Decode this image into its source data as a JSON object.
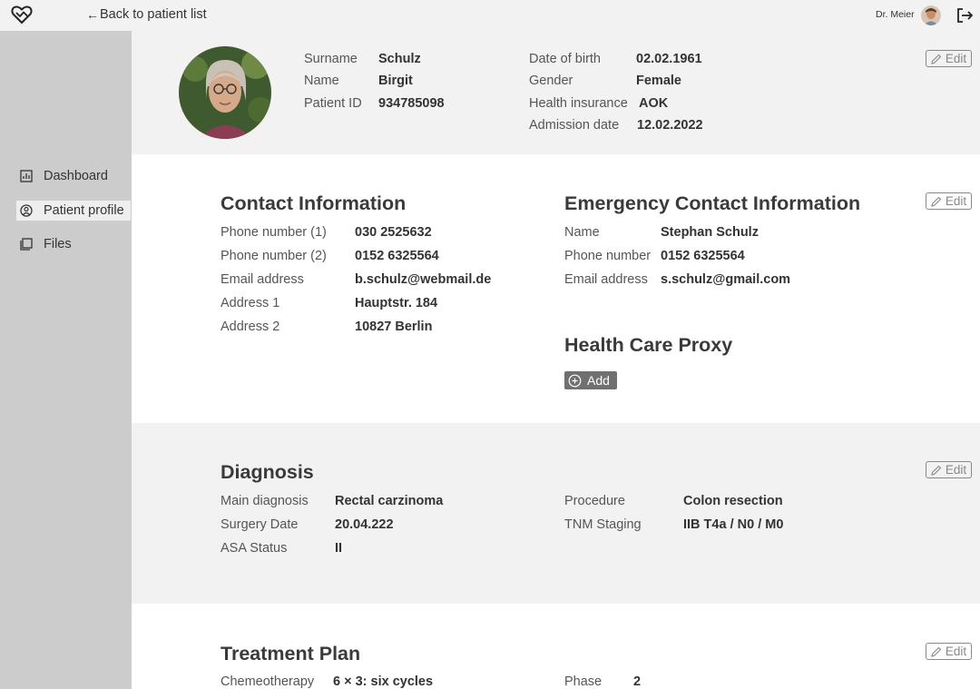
{
  "topbar": {
    "back_label": "Back to patient list",
    "user_name": "Dr. Meier"
  },
  "sidebar": {
    "items": [
      {
        "label": "Dashboard",
        "icon": "chart-icon"
      },
      {
        "label": "Patient profile",
        "icon": "user-circle-icon"
      },
      {
        "label": "Files",
        "icon": "files-icon"
      }
    ]
  },
  "patient": {
    "surname_label": "Surname",
    "surname": "Schulz",
    "name_label": "Name",
    "name": "Birgit",
    "id_label": "Patient ID",
    "id": "934785098",
    "dob_label": "Date of birth",
    "dob": "02.02.1961",
    "gender_label": "Gender",
    "gender": "Female",
    "insurance_label": "Health insurance",
    "insurance": "AOK",
    "admission_label": "Admission date",
    "admission": "12.02.2022"
  },
  "edit_label": "Edit",
  "contact": {
    "title": "Contact Information",
    "rows": [
      {
        "label": "Phone number (1)",
        "value": "030 2525632"
      },
      {
        "label": "Phone number (2)",
        "value": "0152 6325564"
      },
      {
        "label": "Email address",
        "value": "b.schulz@webmail.de"
      },
      {
        "label": "Address 1",
        "value": "Hauptstr. 184"
      },
      {
        "label": "Address 2",
        "value": "10827 Berlin"
      }
    ]
  },
  "emergency": {
    "title": "Emergency Contact Information",
    "rows": [
      {
        "label": "Name",
        "value": "Stephan Schulz"
      },
      {
        "label": "Phone number",
        "value": "0152 6325564"
      },
      {
        "label": "Email address",
        "value": "s.schulz@gmail.com"
      }
    ]
  },
  "proxy": {
    "title": "Health Care Proxy",
    "add_label": "Add"
  },
  "diagnosis": {
    "title": "Diagnosis",
    "main_label": "Main diagnosis",
    "main": "Rectal carzinoma",
    "surgery_label": "Surgery Date",
    "surgery": "20.04.222",
    "asa_label": "ASA Status",
    "asa": "II",
    "procedure_label": "Procedure",
    "procedure": "Colon resection",
    "tnm_label": "TNM Staging",
    "tnm": "IIB T4a / N0 / M0"
  },
  "treatment": {
    "title": "Treatment Plan",
    "chemo_label": "Chemeotherapy",
    "chemo": "6 × 3:  six cycles",
    "phase_label": "Phase",
    "phase": "2"
  }
}
